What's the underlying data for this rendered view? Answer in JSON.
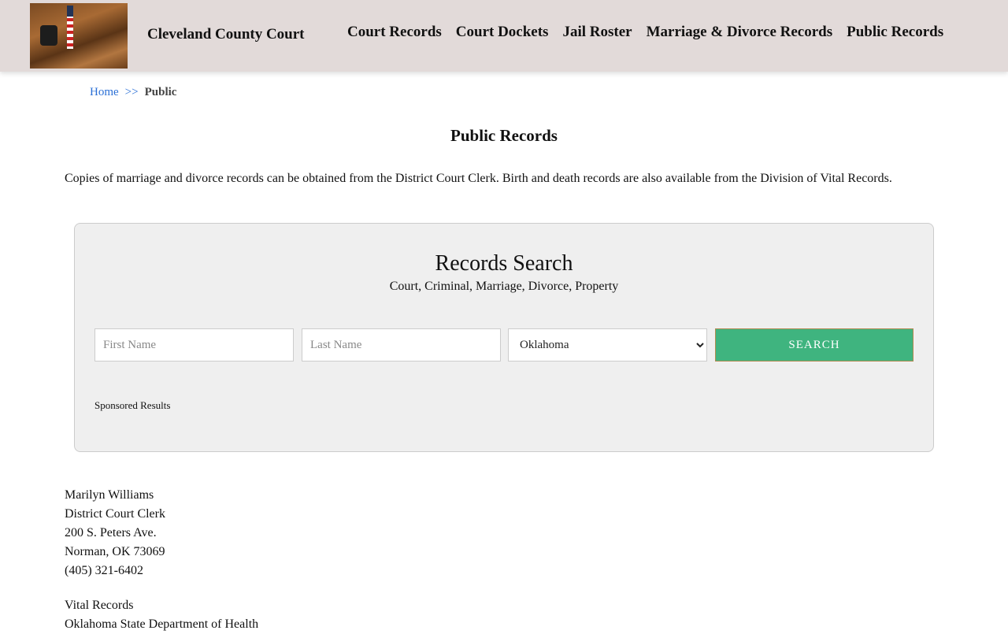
{
  "header": {
    "title": "Cleveland County Court",
    "nav": [
      "Court Records",
      "Court Dockets",
      "Jail Roster",
      "Marriage & Divorce Records",
      "Public Records"
    ]
  },
  "breadcrumb": {
    "home": "Home",
    "sep": ">>",
    "current": "Public"
  },
  "page": {
    "title": "Public Records",
    "intro": "Copies of marriage and divorce records can be obtained from the District Court Clerk. Birth and death records are also available from the Division of Vital Records."
  },
  "search": {
    "title": "Records Search",
    "subtitle": "Court, Criminal, Marriage, Divorce, Property",
    "first_placeholder": "First Name",
    "last_placeholder": "Last Name",
    "state": "Oklahoma",
    "button": "SEARCH",
    "sponsored": "Sponsored Results",
    "button_color": "#3fb47f"
  },
  "clerk": [
    "Marilyn Williams",
    "District Court Clerk",
    "200 S. Peters Ave.",
    "Norman, OK 73069",
    "(405) 321-6402"
  ],
  "vital": [
    "Vital Records",
    "Oklahoma State Department of Health"
  ]
}
